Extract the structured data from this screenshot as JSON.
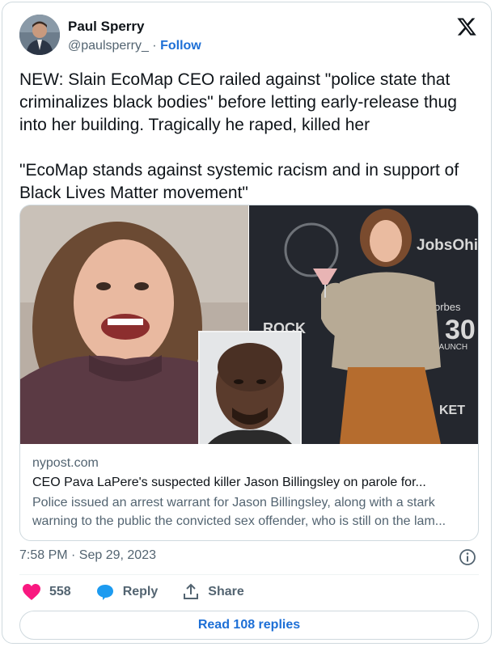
{
  "author": {
    "name": "Paul Sperry",
    "handle": "@paulsperry_",
    "separator": "·",
    "follow_label": "Follow"
  },
  "icons": {
    "platform_logo": "x-logo-icon",
    "info": "info-icon",
    "like": "heart-icon",
    "reply": "speech-bubble-icon",
    "share": "share-upload-icon"
  },
  "tweet": {
    "paragraph1": "NEW: Slain EcoMap CEO railed against \"police state that criminalizes black bodies\" before letting early-release thug into her building. Tragically he raped, killed her",
    "paragraph2": "\"EcoMap stands against systemic racism and in support of Black Lives Matter movement\""
  },
  "media": {
    "backdrop_logo_text": "JobsOhio",
    "backdrop_text_1": "ROCK",
    "backdrop_text_2": "orbes",
    "backdrop_text_3": "30",
    "backdrop_text_4": "LAUNCH",
    "backdrop_text_5": "KET"
  },
  "link_card": {
    "domain": "nypost.com",
    "title": "CEO Pava LaPere's suspected killer Jason Billingsley on parole for...",
    "description": "Police issued an arrest warrant for Jason Billingsley, along with a stark warning to the public the convicted sex offender, who is still on the lam..."
  },
  "timestamp": "7:58 PM · Sep 29, 2023",
  "actions": {
    "likes_count": "558",
    "reply_label": "Reply",
    "share_label": "Share"
  },
  "read_replies_label": "Read 108 replies",
  "colors": {
    "accent": "#1d6fd6",
    "like": "#f91880",
    "secondary_text": "#536471",
    "border": "#cfd9de"
  }
}
